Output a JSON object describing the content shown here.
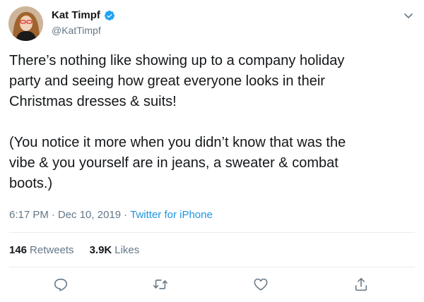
{
  "author": {
    "display_name": "Kat Timpf",
    "handle": "@KatTimpf",
    "verified": true,
    "avatar_icon": "profile-photo"
  },
  "tweet": {
    "paragraph_1": "There’s nothing like showing up to a company holiday\nparty and seeing how great everyone looks in their\nChristmas dresses & suits!",
    "paragraph_2": "(You notice it more when you didn’t know that was the\nvibe & you yourself are in jeans, a sweater & combat\nboots.)"
  },
  "meta": {
    "time": "6:17 PM",
    "separator_1": "·",
    "date": "Dec 10, 2019",
    "separator_2": "·",
    "source": "Twitter for iPhone"
  },
  "stats": {
    "retweets_count": "146",
    "retweets_label": "Retweets",
    "likes_count": "3.9K",
    "likes_label": "Likes"
  },
  "actions": [
    "reply-icon",
    "retweet-icon",
    "like-icon",
    "share-icon"
  ],
  "colors": {
    "text": "#14171a",
    "secondary": "#657786",
    "link": "#1b95e0",
    "verified": "#1da1f2",
    "divider": "#e6ecf0"
  }
}
